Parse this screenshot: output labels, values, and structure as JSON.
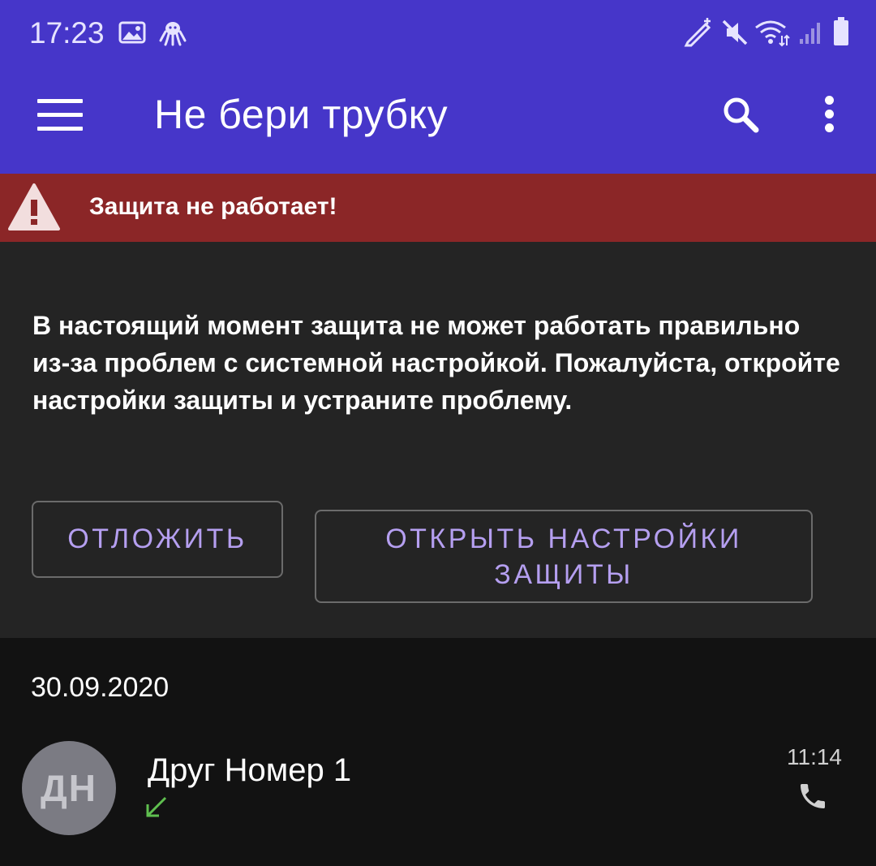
{
  "status_bar": {
    "time": "17:23"
  },
  "app_bar": {
    "title": "Не бери трубку"
  },
  "warning": {
    "title": "Защита не работает!",
    "message": "В настоящий момент защита не может работать правильно из-за проблем с системной настройкой. Пожалуйста, откройте настройки защиты и устраните проблему.",
    "postpone_label": "ОТЛОЖИТЬ",
    "open_settings_label": "ОТКРЫТЬ НАСТРОЙКИ ЗАЩИТЫ"
  },
  "call_log": {
    "date": "30.09.2020",
    "items": [
      {
        "initials": "ДН",
        "name": "Друг Номер 1",
        "time": "11:14",
        "direction": "incoming"
      }
    ]
  },
  "colors": {
    "primary": "#4636c9",
    "warning_red": "#8b2627",
    "accent_text": "#b59ff0",
    "incoming_green": "#5fbf4f"
  }
}
